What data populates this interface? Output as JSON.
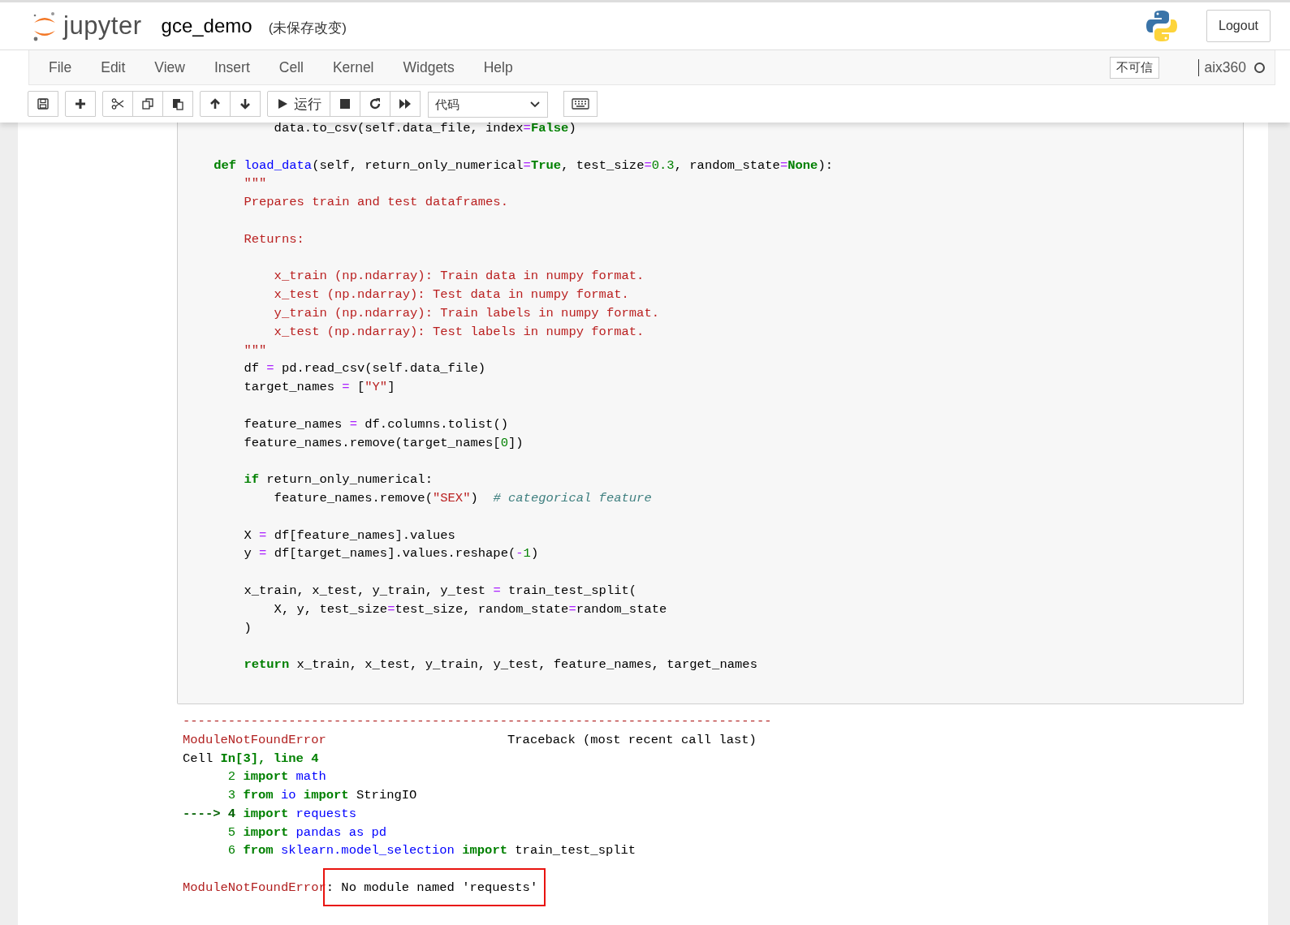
{
  "header": {
    "logo_text": "jupyter",
    "notebook_name": "gce_demo",
    "save_status": "(未保存改变)",
    "logout": "Logout"
  },
  "menubar": {
    "items": [
      "File",
      "Edit",
      "View",
      "Insert",
      "Cell",
      "Kernel",
      "Widgets",
      "Help"
    ],
    "trust": "不可信",
    "kernel_name": "aix360",
    "kernel_busy": false
  },
  "toolbar": {
    "groups": [
      [
        {
          "kind": "save"
        }
      ],
      [
        {
          "kind": "add"
        }
      ],
      [
        {
          "kind": "cut"
        },
        {
          "kind": "copy"
        },
        {
          "kind": "paste"
        }
      ],
      [
        {
          "kind": "up"
        },
        {
          "kind": "down"
        }
      ],
      [
        {
          "kind": "run",
          "label": "运行"
        },
        {
          "kind": "stop"
        },
        {
          "kind": "restart"
        },
        {
          "kind": "fastforward"
        }
      ]
    ],
    "cell_type": "代码"
  },
  "cell": {
    "lines": [
      {
        "kind": "code",
        "tokens": [
          {
            "kind": "text",
            "text": "            data.to_csv(self.data_file, index"
          },
          {
            "kind": "op",
            "text": "="
          },
          {
            "kind": "kw",
            "text": "False"
          },
          {
            "kind": "text",
            "text": ")"
          }
        ]
      },
      {
        "kind": "blank"
      },
      {
        "kind": "code",
        "tokens": [
          {
            "kind": "kw",
            "text": "    def"
          },
          {
            "kind": "name",
            "text": " load_data"
          },
          {
            "kind": "text",
            "text": "(self, return_only_numerical"
          },
          {
            "kind": "op",
            "text": "="
          },
          {
            "kind": "kw",
            "text": "True"
          },
          {
            "kind": "text",
            "text": ", test_size"
          },
          {
            "kind": "op",
            "text": "="
          },
          {
            "kind": "num",
            "text": "0.3"
          },
          {
            "kind": "text",
            "text": ", random_state"
          },
          {
            "kind": "op",
            "text": "="
          },
          {
            "kind": "kw",
            "text": "None"
          },
          {
            "kind": "text",
            "text": "):"
          }
        ]
      },
      {
        "kind": "code",
        "tokens": [
          {
            "kind": "str",
            "text": "        \"\"\""
          }
        ]
      },
      {
        "kind": "code",
        "tokens": [
          {
            "kind": "str",
            "text": "        Prepares train and test dataframes."
          }
        ]
      },
      {
        "kind": "blank"
      },
      {
        "kind": "code",
        "tokens": [
          {
            "kind": "str",
            "text": "        Returns:"
          }
        ]
      },
      {
        "kind": "blank"
      },
      {
        "kind": "code",
        "tokens": [
          {
            "kind": "str",
            "text": "            x_train (np.ndarray): Train data in numpy format."
          }
        ]
      },
      {
        "kind": "code",
        "tokens": [
          {
            "kind": "str",
            "text": "            x_test (np.ndarray): Test data in numpy format."
          }
        ]
      },
      {
        "kind": "code",
        "tokens": [
          {
            "kind": "str",
            "text": "            y_train (np.ndarray): Train labels in numpy format."
          }
        ]
      },
      {
        "kind": "code",
        "tokens": [
          {
            "kind": "str",
            "text": "            x_test (np.ndarray): Test labels in numpy format."
          }
        ]
      },
      {
        "kind": "code",
        "tokens": [
          {
            "kind": "str",
            "text": "        \"\"\""
          }
        ]
      },
      {
        "kind": "code",
        "tokens": [
          {
            "kind": "text",
            "text": "        df "
          },
          {
            "kind": "op",
            "text": "="
          },
          {
            "kind": "text",
            "text": " pd.read_csv(self.data_file)"
          }
        ]
      },
      {
        "kind": "code",
        "tokens": [
          {
            "kind": "text",
            "text": "        target_names "
          },
          {
            "kind": "op",
            "text": "="
          },
          {
            "kind": "text",
            "text": " ["
          },
          {
            "kind": "str",
            "text": "\"Y\""
          },
          {
            "kind": "text",
            "text": "]"
          }
        ]
      },
      {
        "kind": "blank"
      },
      {
        "kind": "code",
        "tokens": [
          {
            "kind": "text",
            "text": "        feature_names "
          },
          {
            "kind": "op",
            "text": "="
          },
          {
            "kind": "text",
            "text": " df.columns.tolist()"
          }
        ]
      },
      {
        "kind": "code",
        "tokens": [
          {
            "kind": "text",
            "text": "        feature_names.remove(target_names["
          },
          {
            "kind": "num",
            "text": "0"
          },
          {
            "kind": "text",
            "text": "])"
          }
        ]
      },
      {
        "kind": "blank"
      },
      {
        "kind": "code",
        "tokens": [
          {
            "kind": "kw",
            "text": "        if"
          },
          {
            "kind": "text",
            "text": " return_only_numerical:"
          }
        ]
      },
      {
        "kind": "code",
        "tokens": [
          {
            "kind": "text",
            "text": "            feature_names.remove("
          },
          {
            "kind": "str",
            "text": "\"SEX\""
          },
          {
            "kind": "text",
            "text": ")  "
          },
          {
            "kind": "comment",
            "text": "# categorical feature"
          }
        ]
      },
      {
        "kind": "blank"
      },
      {
        "kind": "code",
        "tokens": [
          {
            "kind": "text",
            "text": "        X "
          },
          {
            "kind": "op",
            "text": "="
          },
          {
            "kind": "text",
            "text": " df[feature_names].values"
          }
        ]
      },
      {
        "kind": "code",
        "tokens": [
          {
            "kind": "text",
            "text": "        y "
          },
          {
            "kind": "op",
            "text": "="
          },
          {
            "kind": "text",
            "text": " df[target_names].values.reshape("
          },
          {
            "kind": "op",
            "text": "-"
          },
          {
            "kind": "num",
            "text": "1"
          },
          {
            "kind": "text",
            "text": ")"
          }
        ]
      },
      {
        "kind": "blank"
      },
      {
        "kind": "code",
        "tokens": [
          {
            "kind": "text",
            "text": "        x_train, x_test, y_train, y_test "
          },
          {
            "kind": "op",
            "text": "="
          },
          {
            "kind": "text",
            "text": " train_test_split("
          }
        ]
      },
      {
        "kind": "code",
        "tokens": [
          {
            "kind": "text",
            "text": "            X, y, test_size"
          },
          {
            "kind": "op",
            "text": "="
          },
          {
            "kind": "text",
            "text": "test_size, random_state"
          },
          {
            "kind": "op",
            "text": "="
          },
          {
            "kind": "text",
            "text": "random_state"
          }
        ]
      },
      {
        "kind": "code",
        "tokens": [
          {
            "kind": "text",
            "text": "        )"
          }
        ]
      },
      {
        "kind": "blank"
      },
      {
        "kind": "code",
        "tokens": [
          {
            "kind": "kw",
            "text": "        return"
          },
          {
            "kind": "text",
            "text": " x_train, x_test, y_train, y_test, feature_names, target_names"
          }
        ]
      }
    ]
  },
  "output": {
    "lines": [
      {
        "kind": "code",
        "highlighted": false,
        "tokens": [
          {
            "kind": "err",
            "text": "------------------------------------------------------------------------------"
          }
        ]
      },
      {
        "kind": "code",
        "highlighted": false,
        "tokens": [
          {
            "kind": "err",
            "text": "ModuleNotFoundError"
          },
          {
            "kind": "text",
            "text": "                        Traceback (most recent call last)"
          }
        ]
      },
      {
        "kind": "code",
        "highlighted": false,
        "tokens": [
          {
            "kind": "text",
            "text": "Cell "
          },
          {
            "kind": "kw",
            "text": "In[3], line 4"
          }
        ]
      },
      {
        "kind": "code",
        "highlighted": false,
        "tokens": [
          {
            "kind": "lineno",
            "text": "      2 "
          },
          {
            "kind": "kw",
            "text": "import"
          },
          {
            "kind": "mod",
            "text": " math"
          }
        ]
      },
      {
        "kind": "code",
        "highlighted": false,
        "tokens": [
          {
            "kind": "lineno",
            "text": "      3 "
          },
          {
            "kind": "kw",
            "text": "from"
          },
          {
            "kind": "mod",
            "text": " io"
          },
          {
            "kind": "kw",
            "text": " import"
          },
          {
            "kind": "text",
            "text": " StringIO"
          }
        ]
      },
      {
        "kind": "code",
        "highlighted": false,
        "tokens": [
          {
            "kind": "arrow",
            "text": "----> 4 "
          },
          {
            "kind": "kw",
            "text": "import"
          },
          {
            "kind": "mod",
            "text": " requests"
          }
        ]
      },
      {
        "kind": "code",
        "highlighted": false,
        "tokens": [
          {
            "kind": "lineno",
            "text": "      5 "
          },
          {
            "kind": "kw",
            "text": "import"
          },
          {
            "kind": "mod",
            "text": " pandas as pd"
          }
        ]
      },
      {
        "kind": "code",
        "highlighted": false,
        "tokens": [
          {
            "kind": "lineno",
            "text": "      6 "
          },
          {
            "kind": "kw",
            "text": "from"
          },
          {
            "kind": "mod",
            "text": " sklearn.model_selection"
          },
          {
            "kind": "kw",
            "text": " import"
          },
          {
            "kind": "text",
            "text": " train_test_split"
          }
        ]
      },
      {
        "kind": "blank"
      },
      {
        "kind": "code",
        "highlighted": true,
        "tokens": [
          {
            "kind": "err",
            "text": "ModuleNotFoundError"
          },
          {
            "kind": "text",
            "text": ": No module named 'requests'"
          }
        ]
      }
    ]
  }
}
